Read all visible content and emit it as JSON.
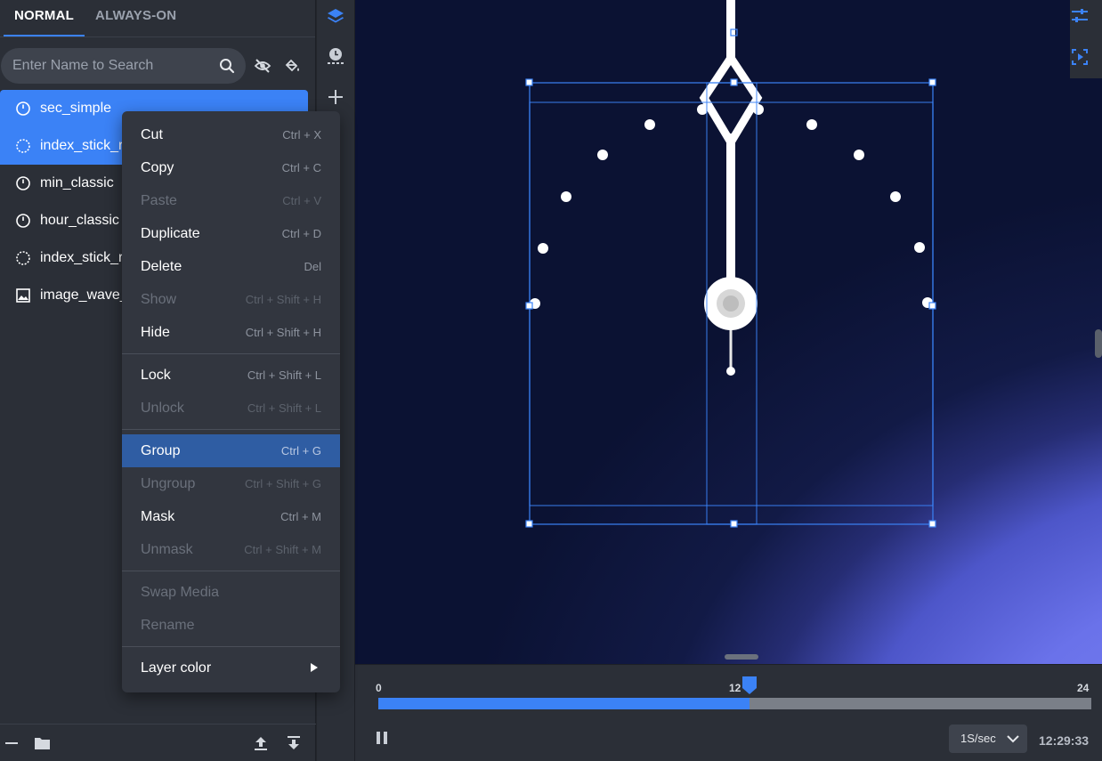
{
  "layers_panel": {
    "tabs": [
      {
        "label": "NORMAL",
        "active": true
      },
      {
        "label": "ALWAYS-ON",
        "active": false
      }
    ],
    "search": {
      "placeholder": "Enter Name to Search"
    },
    "layers": [
      {
        "name": "sec_simple",
        "icon": "clock-hand-icon",
        "selected": true
      },
      {
        "name": "index_stick_ro",
        "icon": "dial-index-icon",
        "selected": true
      },
      {
        "name": "min_classic",
        "icon": "clock-hand-icon",
        "selected": false
      },
      {
        "name": "hour_classic",
        "icon": "clock-hand-icon",
        "selected": false
      },
      {
        "name": "index_stick_ro",
        "icon": "dial-index-icon",
        "selected": false
      },
      {
        "name": "image_wave_",
        "icon": "image-icon",
        "selected": false
      }
    ]
  },
  "context_menu": {
    "items": [
      {
        "label": "Cut",
        "shortcut": "Ctrl + X",
        "disabled": false
      },
      {
        "label": "Copy",
        "shortcut": "Ctrl + C",
        "disabled": false
      },
      {
        "label": "Paste",
        "shortcut": "Ctrl + V",
        "disabled": true
      },
      {
        "label": "Duplicate",
        "shortcut": "Ctrl + D",
        "disabled": false
      },
      {
        "label": "Delete",
        "shortcut": "Del",
        "disabled": false
      },
      {
        "label": "Show",
        "shortcut": "Ctrl + Shift + H",
        "disabled": true
      },
      {
        "label": "Hide",
        "shortcut": "Ctrl + Shift + H",
        "disabled": false
      },
      {
        "label": "Lock",
        "shortcut": "Ctrl + Shift + L",
        "disabled": false
      },
      {
        "label": "Unlock",
        "shortcut": "Ctrl + Shift + L",
        "disabled": true
      },
      {
        "label": "Group",
        "shortcut": "Ctrl + G",
        "disabled": false,
        "highlighted": true
      },
      {
        "label": "Ungroup",
        "shortcut": "Ctrl + Shift + G",
        "disabled": true
      },
      {
        "label": "Mask",
        "shortcut": "Ctrl + M",
        "disabled": false
      },
      {
        "label": "Unmask",
        "shortcut": "Ctrl + Shift + M",
        "disabled": true
      },
      {
        "label": "Swap Media",
        "disabled": true
      },
      {
        "label": "Rename",
        "disabled": true
      },
      {
        "label": "Layer color",
        "has_submenu": true
      }
    ]
  },
  "timeline": {
    "start_label": "0",
    "mid_label": "12",
    "end_label": "24",
    "progress": 0.52,
    "speed": "1S/sec",
    "time": "12:29:33"
  },
  "colors": {
    "accent": "#3b82f6",
    "panel": "#2b2f37",
    "menu": "#32363f",
    "highlight": "#2f5da3"
  }
}
